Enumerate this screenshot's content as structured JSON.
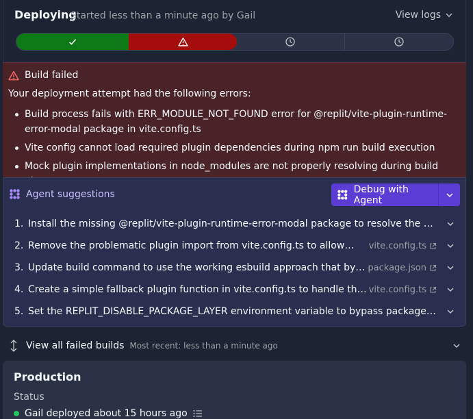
{
  "deploy": {
    "title": "Deploying",
    "subtitle": "Started less than a minute ago by Gail",
    "view_logs": "View logs",
    "steps": [
      "complete",
      "error",
      "pending",
      "pending"
    ]
  },
  "error": {
    "title": "Build failed",
    "intro": "Your deployment attempt had the following errors:",
    "items": [
      "Build process fails with ERR_MODULE_NOT_FOUND error for @replit/vite-plugin-runtime-error-modal package in vite.config.ts",
      "Vite config cannot load required plugin dependencies during npm run build execution",
      "Mock plugin implementations in node_modules are not properly resolving during build phase"
    ]
  },
  "agent": {
    "title": "Agent suggestions",
    "debug_label": "Debug with Agent",
    "suggestions": [
      {
        "num": "1.",
        "text": "Install the missing @replit/vite-plugin-runtime-error-modal package to resolve the build error",
        "file": ""
      },
      {
        "num": "2.",
        "text": "Remove the problematic plugin import from vite.config.ts to allow build to...",
        "file": "vite.config.ts"
      },
      {
        "num": "3.",
        "text": "Update build command to use the working esbuild approach that bypasses Vit...",
        "file": "package.json"
      },
      {
        "num": "4.",
        "text": "Create a simple fallback plugin function in vite.config.ts to handle the missing...",
        "file": "vite.config.ts"
      },
      {
        "num": "5.",
        "text": "Set the REPLIT_DISABLE_PACKAGE_LAYER environment variable to bypass package caching...",
        "file": ""
      }
    ]
  },
  "failed_builds": {
    "label": "View all failed builds",
    "sub": "Most recent: less than a minute ago"
  },
  "production": {
    "title": "Production",
    "status_label": "Status",
    "status_text": "Gail deployed about 15 hours ago"
  },
  "colors": {
    "success": "#0e7a17",
    "error": "#a50d0d",
    "accent": "#5b3dd6"
  }
}
